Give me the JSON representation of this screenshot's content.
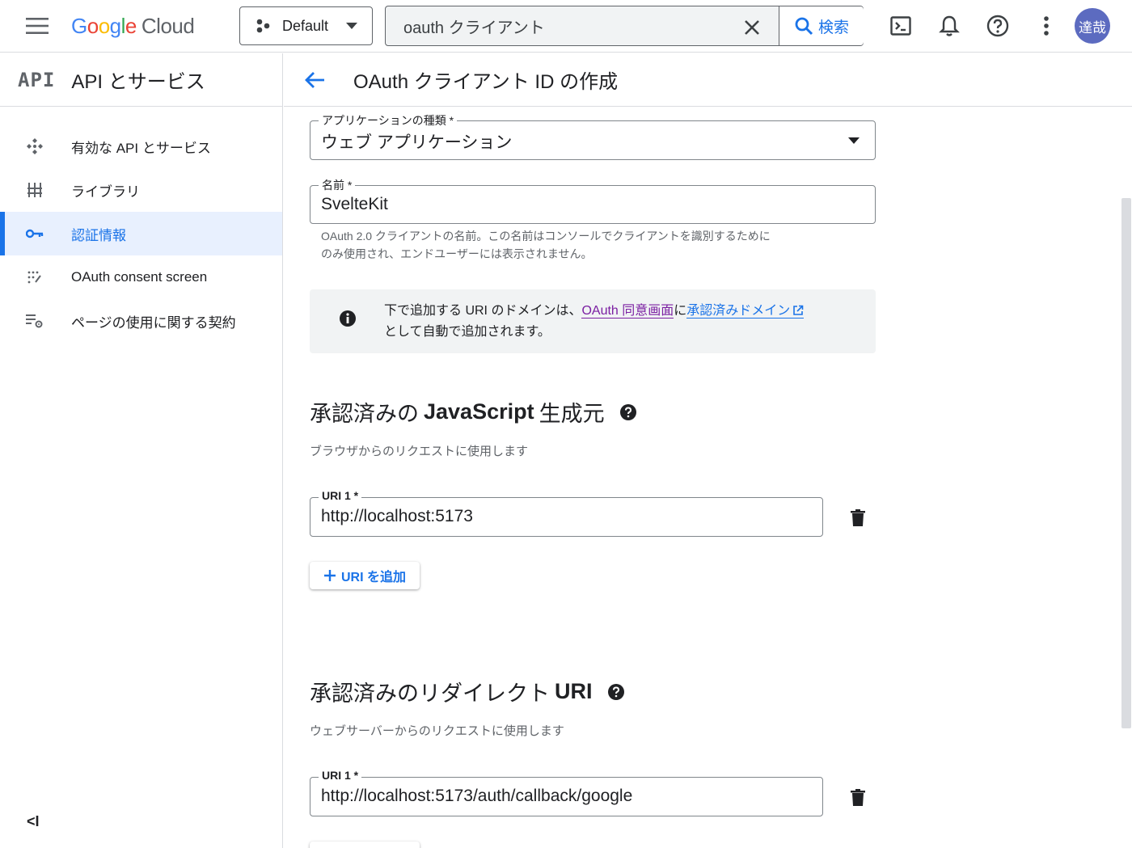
{
  "header": {
    "logo_google": "Google",
    "logo_cloud": "Cloud",
    "project": "Default",
    "search_value": "oauth クライアント",
    "search_button": "検索",
    "avatar_initials": "達哉"
  },
  "sidebar": {
    "api_logo": "API",
    "title": "API とサービス",
    "items": [
      {
        "label": "有効な API とサービス",
        "icon": "enabled-apis-icon"
      },
      {
        "label": "ライブラリ",
        "icon": "library-icon"
      },
      {
        "label": "認証情報",
        "icon": "key-icon",
        "active": true
      },
      {
        "label": "OAuth consent screen",
        "icon": "consent-icon"
      },
      {
        "label": "ページの使用に関する契約",
        "icon": "agreements-icon"
      }
    ],
    "collapse": "<I"
  },
  "page": {
    "title": "OAuth クライアント ID の作成"
  },
  "form": {
    "app_type_label": "アプリケーションの種類 *",
    "app_type_value": "ウェブ アプリケーション",
    "name_label": "名前 *",
    "name_value": "SvelteKit",
    "name_hint": "OAuth 2.0 クライアントの名前。この名前はコンソールでクライアントを識別するために",
    "name_hint_2": "のみ使用され、エンドユーザーには表示されません。",
    "info_text_1": "下で追加する URI のドメインは、",
    "info_link_consent": "OAuth 同意画面",
    "info_text_2": "に",
    "info_link_domain": "承認済みドメイン",
    "info_text_3": "として自動で追加されます。"
  },
  "js_origins": {
    "title_prefix": "承認済みの ",
    "title_bold": "JavaScript",
    "title_suffix": " 生成元",
    "description": "ブラウザからのリクエストに使用します",
    "uri_label": "URI 1 *",
    "uri_value": "http://localhost:5173",
    "add_button": "URI を追加"
  },
  "redirect_uris": {
    "title_prefix": "承認済みのリダイレクト ",
    "title_bold": "URI",
    "description": "ウェブサーバーからのリクエストに使用します",
    "uri_label": "URI 1 *",
    "uri_value": "http://localhost:5173/auth/callback/google"
  },
  "colors": {
    "accent": "#1a73e8",
    "consent_link": "#7b1fa2",
    "avatar": "#5c6bc0"
  }
}
